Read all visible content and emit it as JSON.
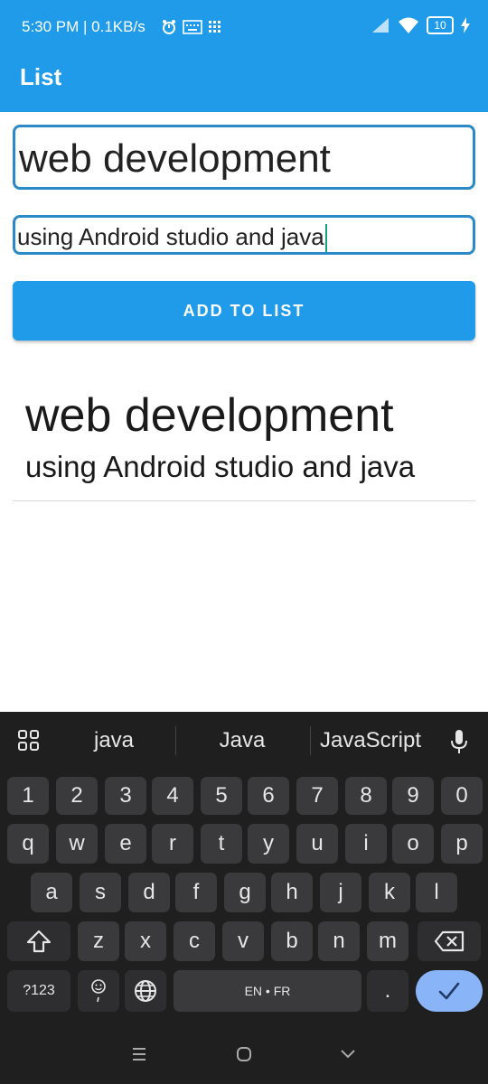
{
  "status_bar": {
    "time": "5:30 PM | 0.1KB/s",
    "battery": "10"
  },
  "app_bar": {
    "title": "List"
  },
  "form": {
    "title_value": "web development",
    "description_value": "using Android studio and java",
    "add_button_label": "ADD TO LIST"
  },
  "list": {
    "items": [
      {
        "title": "web development",
        "description": "using Android studio and java"
      }
    ]
  },
  "keyboard": {
    "suggestions": [
      "java",
      "Java",
      "JavaScript"
    ],
    "number_row": [
      "1",
      "2",
      "3",
      "4",
      "5",
      "6",
      "7",
      "8",
      "9",
      "0"
    ],
    "row1": [
      "q",
      "w",
      "e",
      "r",
      "t",
      "y",
      "u",
      "i",
      "o",
      "p"
    ],
    "row2": [
      "a",
      "s",
      "d",
      "f",
      "g",
      "h",
      "j",
      "k",
      "l"
    ],
    "row3": [
      "z",
      "x",
      "c",
      "v",
      "b",
      "n",
      "m"
    ],
    "symbols_key": "?123",
    "space_label": "EN • FR",
    "period_key": "."
  },
  "colors": {
    "primary": "#1f9be9",
    "input_border": "#2c89c8",
    "keyboard_bg": "#1f1f1f",
    "enter_key": "#8ab4f8"
  }
}
